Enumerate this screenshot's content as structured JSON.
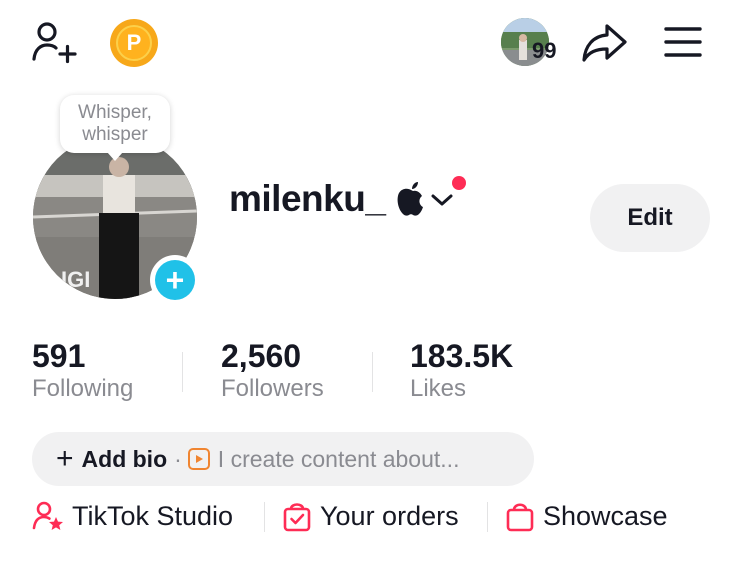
{
  "top_bar": {
    "add_friend_icon": "add-friend-icon",
    "coin_icon": "coin-icon",
    "coin_letter": "P",
    "notification_count": "99",
    "share_icon": "share-icon",
    "menu_icon": "hamburger-menu-icon"
  },
  "profile": {
    "bubble_text_line1": "Whisper,",
    "bubble_text_line2": "whisper",
    "username": "milenku_",
    "edit_label": "Edit",
    "add_photo_symbol": "+"
  },
  "stats": [
    {
      "value": "591",
      "label": "Following"
    },
    {
      "value": "2,560",
      "label": "Followers"
    },
    {
      "value": "183.5K",
      "label": "Likes"
    }
  ],
  "bio": {
    "add_symbol": "+",
    "add_bio_label": "Add bio",
    "separator": "·",
    "prompt": "I create content about..."
  },
  "links": [
    {
      "label": "TikTok Studio",
      "icon": "studio-icon"
    },
    {
      "label": "Your orders",
      "icon": "orders-bag-icon"
    },
    {
      "label": "Showcase",
      "icon": "shopping-bag-icon"
    }
  ],
  "colors": {
    "accent": "#fe2c55",
    "cyan": "#20c1e8",
    "coin": "#f7a81a",
    "text": "#161823",
    "muted": "#8a8b91",
    "pill_bg": "#f1f1f2"
  }
}
